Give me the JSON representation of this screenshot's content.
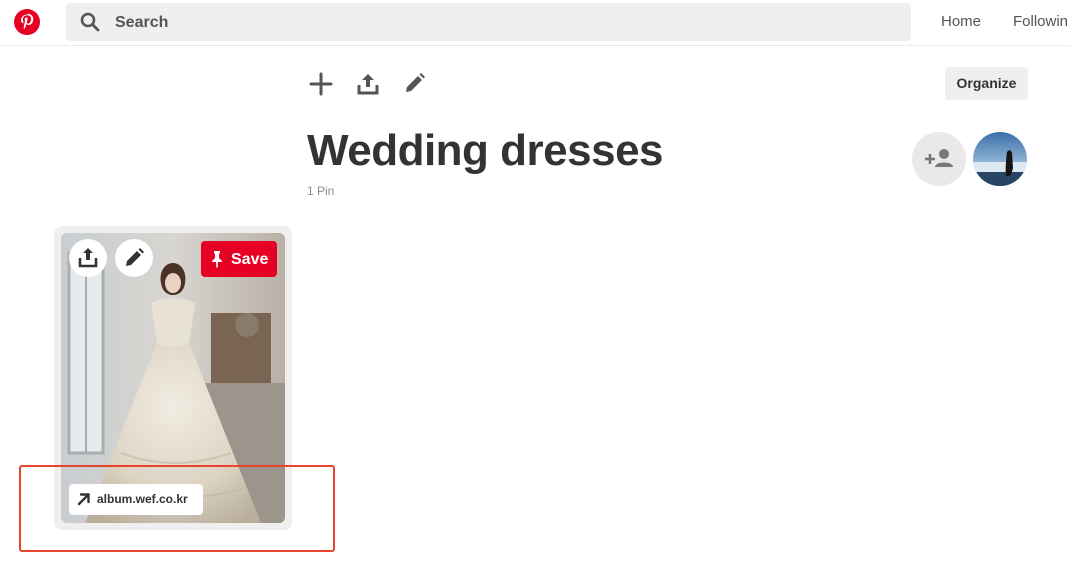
{
  "header": {
    "logo_icon": "pinterest-logo",
    "search_placeholder": "Search",
    "nav": {
      "home": "Home",
      "following": "Followin"
    }
  },
  "toolbar": {
    "icons": [
      "plus-icon",
      "share-icon",
      "edit-icon"
    ],
    "organize_label": "Organize"
  },
  "board": {
    "title": "Wedding dresses",
    "pin_count": "1 Pin"
  },
  "pin": {
    "save_label": "Save",
    "source_domain": "album.wef.co.kr"
  },
  "colors": {
    "brand_red": "#e60023",
    "highlight": "#e8452f",
    "text": "#333333",
    "muted": "#8e8e8e",
    "gray_bg": "#efefef"
  }
}
